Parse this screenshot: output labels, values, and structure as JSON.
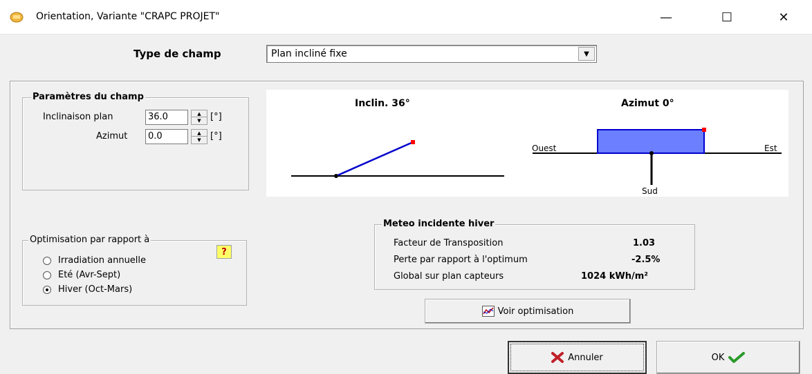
{
  "window": {
    "title": "Orientation, Variante \"CRAPC PROJET\"",
    "controls": {
      "minimize": "—",
      "maximize": "☐",
      "close": "✕"
    }
  },
  "type_champ": {
    "label": "Type de champ",
    "value": "Plan incliné fixe"
  },
  "params": {
    "legend": "Paramètres du champ",
    "inclinaison_label": "Inclinaison plan",
    "inclinaison_value": "36.0",
    "azimut_label": "Azimut",
    "azimut_value": "0.0",
    "unit": "[°]"
  },
  "diagram": {
    "inclin_label": "Inclin. 36°",
    "azimut_label": "Azimut 0°",
    "ouest": "Ouest",
    "est": "Est",
    "sud": "Sud",
    "line_color": "#0000cc",
    "fill_color": "#6b7fff",
    "marker_color": "#ff0000"
  },
  "optimisation": {
    "legend": "Optimisation par rapport à",
    "help": "?",
    "options": [
      {
        "label": "Irradiation annuelle",
        "checked": false
      },
      {
        "label": "Eté (Avr-Sept)",
        "checked": false
      },
      {
        "label": "Hiver (Oct-Mars)",
        "checked": true
      }
    ]
  },
  "meteo": {
    "legend": "Meteo incidente hiver",
    "rows": [
      {
        "label": "Facteur de Transposition",
        "value": "1.03"
      },
      {
        "label": "Perte par rapport à l'optimum",
        "value": "-2.5%"
      },
      {
        "label": "Global sur plan capteurs",
        "value": "1024 kWh/m²"
      }
    ]
  },
  "buttons": {
    "voir_optimisation": "Voir optimisation",
    "annuler": "Annuler",
    "ok": "OK"
  }
}
